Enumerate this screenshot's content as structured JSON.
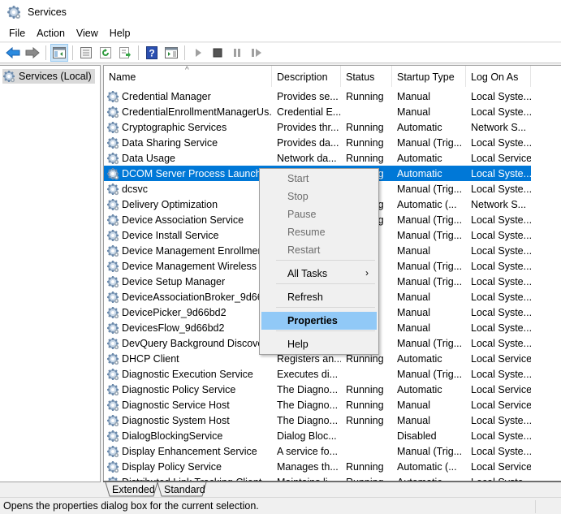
{
  "window": {
    "title": "Services",
    "icon": "gear-icon"
  },
  "menubar": [
    "File",
    "Action",
    "View",
    "Help"
  ],
  "toolbar": [
    {
      "name": "back-arrow-icon"
    },
    {
      "name": "forward-arrow-icon"
    },
    {
      "name": "show-hide-console-tree-icon",
      "active": true
    },
    {
      "name": "properties-sheet-icon"
    },
    {
      "name": "refresh-icon"
    },
    {
      "name": "export-list-icon"
    },
    {
      "name": "help-icon"
    },
    {
      "name": "show-hide-action-pane-icon"
    },
    {
      "name": "start-service-icon"
    },
    {
      "name": "stop-service-icon"
    },
    {
      "name": "pause-service-icon"
    },
    {
      "name": "restart-service-icon"
    }
  ],
  "tree": {
    "item": "Services (Local)"
  },
  "columns": [
    "Name",
    "Description",
    "Status",
    "Startup Type",
    "Log On As"
  ],
  "rows": [
    [
      "Credential Manager",
      "Provides se...",
      "Running",
      "Manual",
      "Local Syste..."
    ],
    [
      "CredentialEnrollmentManagerUs...",
      "Credential E...",
      "",
      "Manual",
      "Local Syste..."
    ],
    [
      "Cryptographic Services",
      "Provides thr...",
      "Running",
      "Automatic",
      "Network S..."
    ],
    [
      "Data Sharing Service",
      "Provides da...",
      "Running",
      "Manual (Trig...",
      "Local Syste..."
    ],
    [
      "Data Usage",
      "Network da...",
      "Running",
      "Automatic",
      "Local Service"
    ],
    [
      "DCOM Server Process Launcher",
      "",
      "Running",
      "Automatic",
      "Local Syste..."
    ],
    [
      "dcsvc",
      "",
      "",
      "Manual (Trig...",
      "Local Syste..."
    ],
    [
      "Delivery Optimization",
      "",
      "Running",
      "Automatic (...",
      "Network S..."
    ],
    [
      "Device Association Service",
      "",
      "Running",
      "Manual (Trig...",
      "Local Syste..."
    ],
    [
      "Device Install Service",
      "",
      "",
      "Manual (Trig...",
      "Local Syste..."
    ],
    [
      "Device Management Enrollment...",
      "",
      "",
      "Manual",
      "Local Syste..."
    ],
    [
      "Device Management Wireless Ap...",
      "",
      "",
      "Manual (Trig...",
      "Local Syste..."
    ],
    [
      "Device Setup Manager",
      "",
      "",
      "Manual (Trig...",
      "Local Syste..."
    ],
    [
      "DeviceAssociationBroker_9d66bd2",
      "",
      "",
      "Manual",
      "Local Syste..."
    ],
    [
      "DevicePicker_9d66bd2",
      "",
      "",
      "Manual",
      "Local Syste..."
    ],
    [
      "DevicesFlow_9d66bd2",
      "",
      "",
      "Manual",
      "Local Syste..."
    ],
    [
      "DevQuery Background Discovery...",
      "",
      "",
      "Manual (Trig...",
      "Local Syste..."
    ],
    [
      "DHCP Client",
      "Registers an...",
      "Running",
      "Automatic",
      "Local Service"
    ],
    [
      "Diagnostic Execution Service",
      "Executes di...",
      "",
      "Manual (Trig...",
      "Local Syste..."
    ],
    [
      "Diagnostic Policy Service",
      "The Diagno...",
      "Running",
      "Automatic",
      "Local Service"
    ],
    [
      "Diagnostic Service Host",
      "The Diagno...",
      "Running",
      "Manual",
      "Local Service"
    ],
    [
      "Diagnostic System Host",
      "The Diagno...",
      "Running",
      "Manual",
      "Local Syste..."
    ],
    [
      "DialogBlockingService",
      "Dialog Bloc...",
      "",
      "Disabled",
      "Local Syste..."
    ],
    [
      "Display Enhancement Service",
      "A service fo...",
      "",
      "Manual (Trig...",
      "Local Syste..."
    ],
    [
      "Display Policy Service",
      "Manages th...",
      "Running",
      "Automatic (...",
      "Local Service"
    ],
    [
      "Distributed Link Tracking Client",
      "Maintains li...",
      "Running",
      "Automatic",
      "Local Syste..."
    ]
  ],
  "selected_row": 5,
  "context_menu": {
    "items": [
      {
        "label": "Start",
        "disabled": true
      },
      {
        "label": "Stop",
        "disabled": true
      },
      {
        "label": "Pause",
        "disabled": true
      },
      {
        "label": "Resume",
        "disabled": true
      },
      {
        "label": "Restart",
        "disabled": true
      },
      {
        "label": "All Tasks",
        "submenu": true
      },
      {
        "label": "Refresh"
      },
      {
        "label": "Properties",
        "highlighted": true
      },
      {
        "label": "Help"
      }
    ],
    "submenu_arrow": "›"
  },
  "tabs": [
    "Extended",
    "Standard"
  ],
  "status": "Opens the properties dialog box for the current selection.",
  "colors": {
    "selection": "#0078d7",
    "menu_highlight": "#91c9f7"
  }
}
